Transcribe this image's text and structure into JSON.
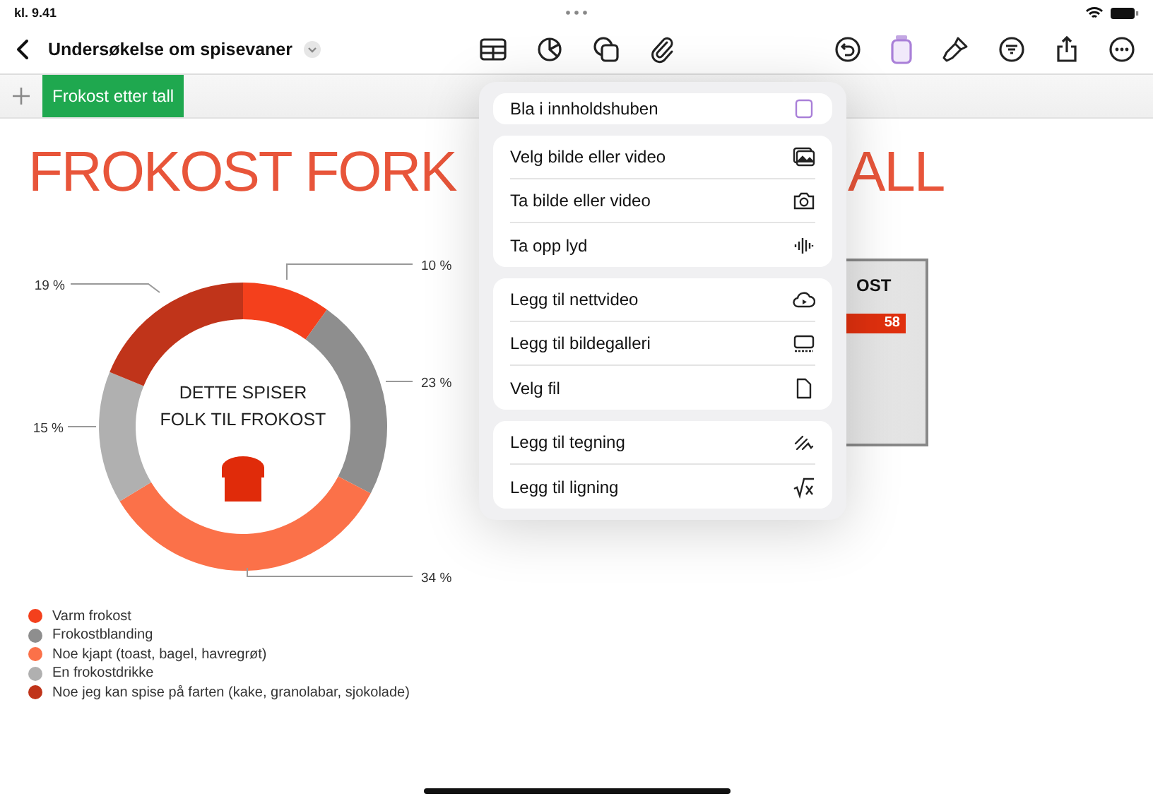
{
  "status_bar": {
    "time": "kl. 9.41"
  },
  "toolbar": {
    "document_title": "Undersøkelse om spisevaner"
  },
  "sheet_tabs": [
    {
      "label": "Frokost etter tall",
      "selected": true
    }
  ],
  "canvas": {
    "title_left": "FROKOST FORK",
    "title_right": "ALL",
    "chart": {
      "center_label": [
        "DETTE SPISER",
        "FOLK TIL FROKOST"
      ],
      "chart_data": {
        "type": "donut",
        "categories": [
          "Varm frokost",
          "Frokostblanding",
          "Noe kjapt (toast, bagel, havregrøt)",
          "En frokostdrikke",
          "Noe jeg kan spise på farten (kake, granolabar, sjokolade)"
        ],
        "values": [
          10,
          23,
          34,
          15,
          19
        ],
        "value_labels": [
          "10 %",
          "23 %",
          "34 %",
          "15 %",
          "19 %"
        ]
      }
    },
    "legend": [
      {
        "color": "#f4401c"
      },
      {
        "color": "#8e8e8e"
      },
      {
        "color": "#fb7149"
      },
      {
        "color": "#b0b0b0"
      },
      {
        "color": "#c0341a"
      }
    ],
    "bar_card": {
      "title": "OST",
      "bar_value": "58"
    }
  },
  "insert_menu": {
    "groups": [
      {
        "items": [
          {
            "label": "Bla i innholdshuben"
          }
        ]
      },
      {
        "items": [
          {
            "label": "Velg bilde eller video"
          },
          {
            "label": "Ta bilde eller video"
          },
          {
            "label": "Ta opp lyd"
          }
        ]
      },
      {
        "items": [
          {
            "label": "Legg til nettvideo"
          },
          {
            "label": "Legg til bildegalleri"
          },
          {
            "label": "Velg fil"
          }
        ]
      },
      {
        "items": [
          {
            "label": "Legg til tegning"
          },
          {
            "label": "Legg til ligning"
          }
        ]
      }
    ]
  }
}
